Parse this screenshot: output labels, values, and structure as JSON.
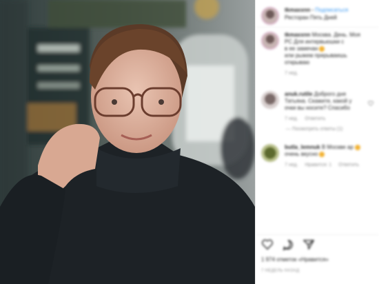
{
  "post": {
    "author": "tkmaxxnn",
    "follow_label": "Подписаться",
    "location": "Ресторан Пять Дней"
  },
  "comments": [
    {
      "user": "tkmaxxnn",
      "text": "Москва. День. Моя",
      "text2": "РС Для интервьюшки с",
      "text3": "в ее замечан",
      "text4": "или рыжем прерываешь",
      "text5": "открываю",
      "time": "7 нед."
    },
    {
      "user": "anuk.rutile",
      "text": "Доброго дня",
      "text2": "Татьяна. Скажите, какой у",
      "text3": "очки вы носите? Спасибо",
      "time": "7 нед.",
      "reply_label": "Ответить",
      "view_replies": "Посмотреть ответы (1)"
    },
    {
      "user": "butla_lemnuk",
      "text": "В Москве ар",
      "text2": "очень вкусно",
      "time": "7 нед.",
      "likes_label": "Нравится: 1",
      "reply_label": "Ответить"
    }
  ],
  "likes_text": "1 974 отметок «Нравится»",
  "post_date": "7 НЕДЕЛЬ НАЗАД",
  "icons": [
    "heart-icon",
    "comment-icon",
    "share-icon"
  ],
  "colors": {
    "link": "#3897f0",
    "text": "#262626",
    "muted": "#8e8e8e",
    "ring": "#d9b3c8"
  }
}
